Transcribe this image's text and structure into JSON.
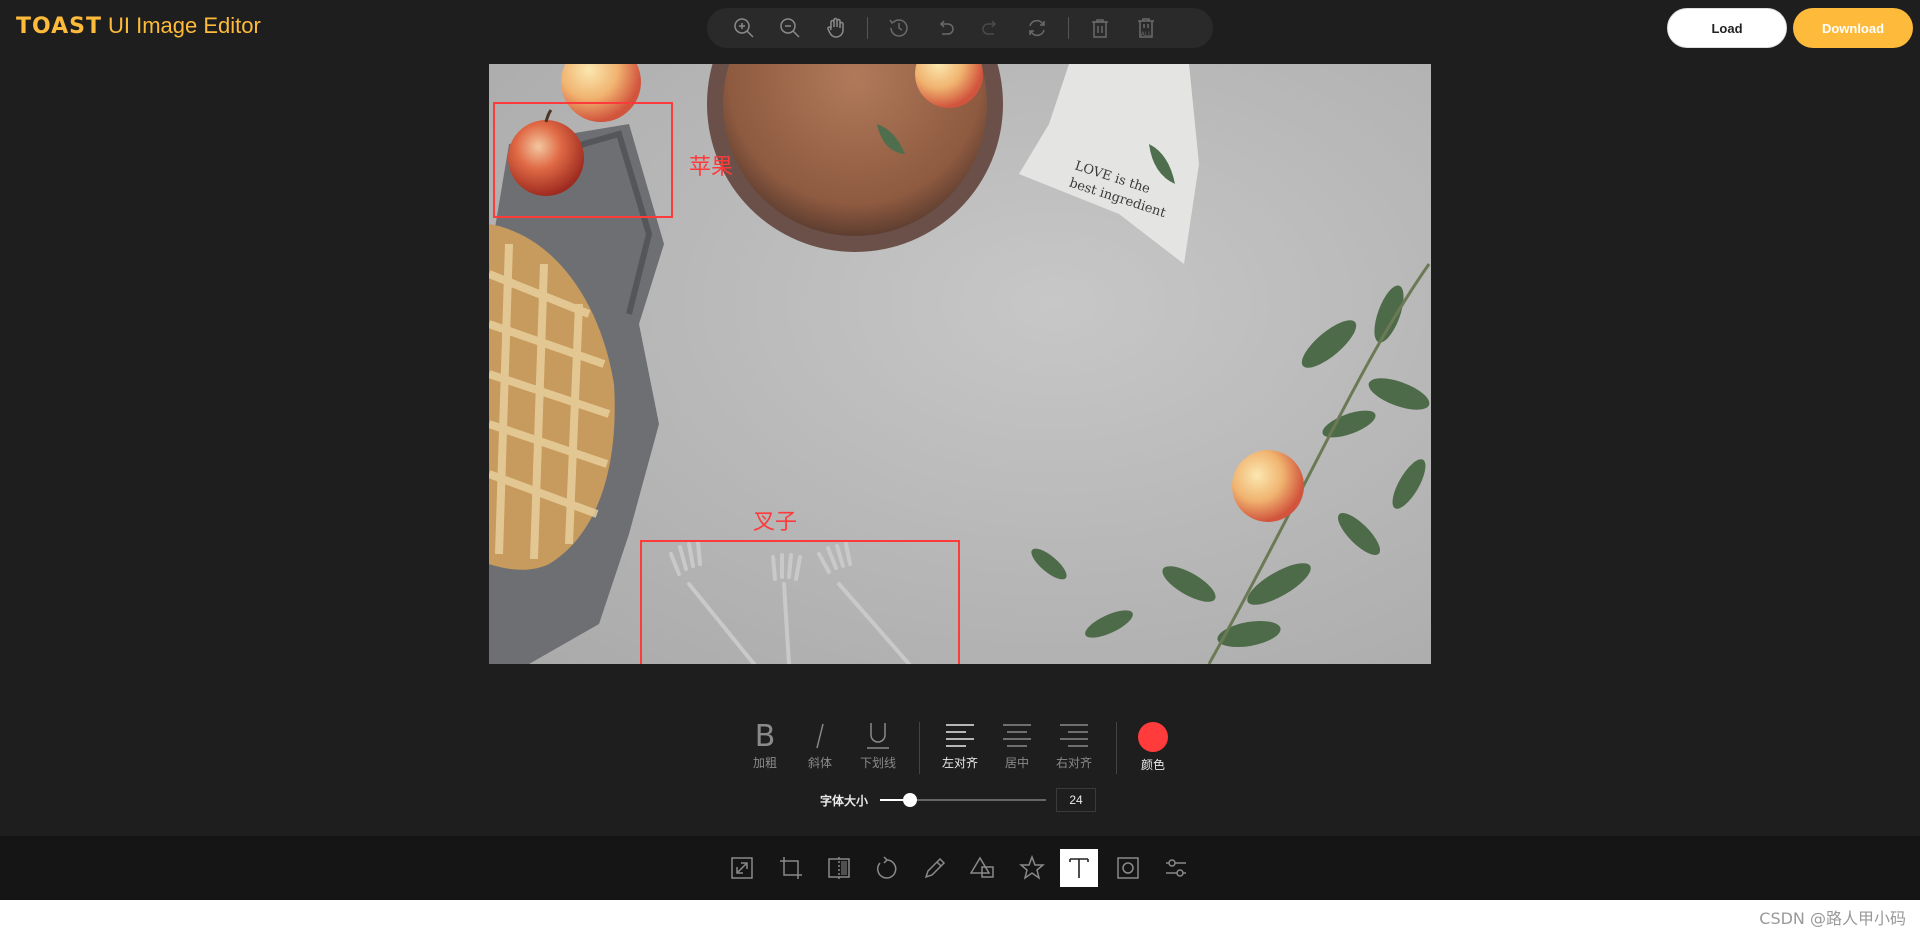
{
  "header": {
    "logo_brand": "TOAST",
    "logo_sub": "UI Image Editor",
    "load_label": "Load",
    "download_label": "Download"
  },
  "top_menu": {
    "icons": [
      "zoom-in-icon",
      "zoom-out-icon",
      "hand-icon",
      "history-icon",
      "undo-icon",
      "redo-icon",
      "reset-icon",
      "delete-icon",
      "delete-all-icon"
    ],
    "delete_all_text": "ALL"
  },
  "canvas": {
    "annotations": {
      "apple_label": "苹果",
      "fork_label": "叉子"
    },
    "napkin_text_line1": "LOVE is the",
    "napkin_text_line2": "best ingredient",
    "annotation_color": "#ff3a3a"
  },
  "text_menu": {
    "bold_label": "加粗",
    "italic_label": "斜体",
    "underline_label": "下划线",
    "align_left_label": "左对齐",
    "align_center_label": "居中",
    "align_right_label": "右对齐",
    "color_label": "颜色",
    "color_value": "#ff3b3b",
    "font_size_label": "字体大小",
    "font_size_value": "24",
    "font_size_fraction": 0.18,
    "active_align": "left"
  },
  "bottom_menu": {
    "icons": [
      "resize-icon",
      "crop-icon",
      "flip-icon",
      "rotate-icon",
      "draw-icon",
      "shape-icon",
      "icon-star-icon",
      "text-icon",
      "mask-icon",
      "filter-icon"
    ],
    "active": "text-icon"
  },
  "watermark": "CSDN @路人甲小码",
  "colors": {
    "accent": "#fdba3b",
    "background": "#1e1e1e",
    "bottom_bar": "#151515"
  }
}
